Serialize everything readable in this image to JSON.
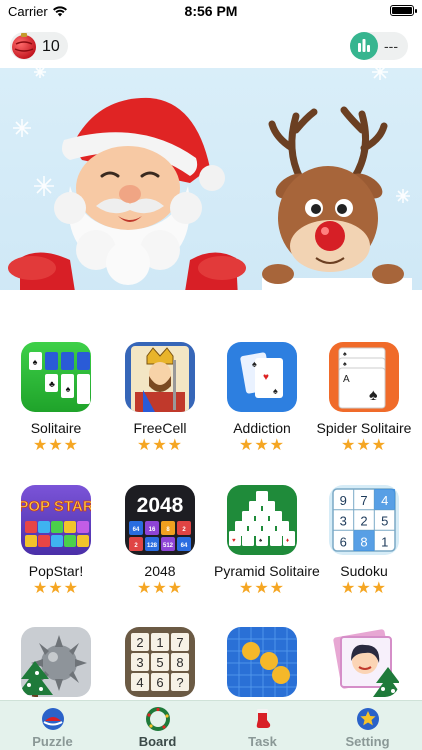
{
  "status": {
    "carrier": "Carrier",
    "time": "8:56 PM"
  },
  "header": {
    "coins": "10",
    "rank": "---"
  },
  "games": [
    {
      "label": "Solitaire",
      "icon": "solitaire-icon",
      "stars": "★★★"
    },
    {
      "label": "FreeCell",
      "icon": "freecell-king-icon",
      "stars": "★★★"
    },
    {
      "label": "Addiction",
      "icon": "addiction-cards-icon",
      "stars": "★★★"
    },
    {
      "label": "Spider Solitaire",
      "icon": "spider-solitaire-icon",
      "stars": "★★★"
    },
    {
      "label": "PopStar!",
      "icon": "popstar-icon",
      "stars": "★★★"
    },
    {
      "label": "2048",
      "icon": "2048-icon",
      "stars": "★★★"
    },
    {
      "label": "Pyramid Solitaire",
      "icon": "pyramid-solitaire-icon",
      "stars": "★★★"
    },
    {
      "label": "Sudoku",
      "icon": "sudoku-icon",
      "stars": "★★★"
    }
  ],
  "icon_text": {
    "popstar": "POP STAR",
    "g2048": "2048",
    "tiles2048": [
      "64",
      "16",
      "8",
      "2",
      "2",
      "128",
      "512",
      "64"
    ],
    "sudoku": [
      "9",
      "7",
      "4",
      "3",
      "2",
      "5",
      "6",
      "8",
      "1"
    ],
    "numbers_puzzle": [
      "2",
      "1",
      "7",
      "3",
      "5",
      "8",
      "4",
      "6",
      "?"
    ]
  },
  "tabs": [
    {
      "label": "Puzzle",
      "icon": "puzzle-tab-icon"
    },
    {
      "label": "Board",
      "icon": "board-tab-icon",
      "active": true
    },
    {
      "label": "Task",
      "icon": "task-tab-icon"
    },
    {
      "label": "Setting",
      "icon": "setting-tab-icon"
    }
  ],
  "colors": {
    "star": "#f5a623",
    "tabbar": "#e4f2ec",
    "accent": "#36b58f"
  }
}
